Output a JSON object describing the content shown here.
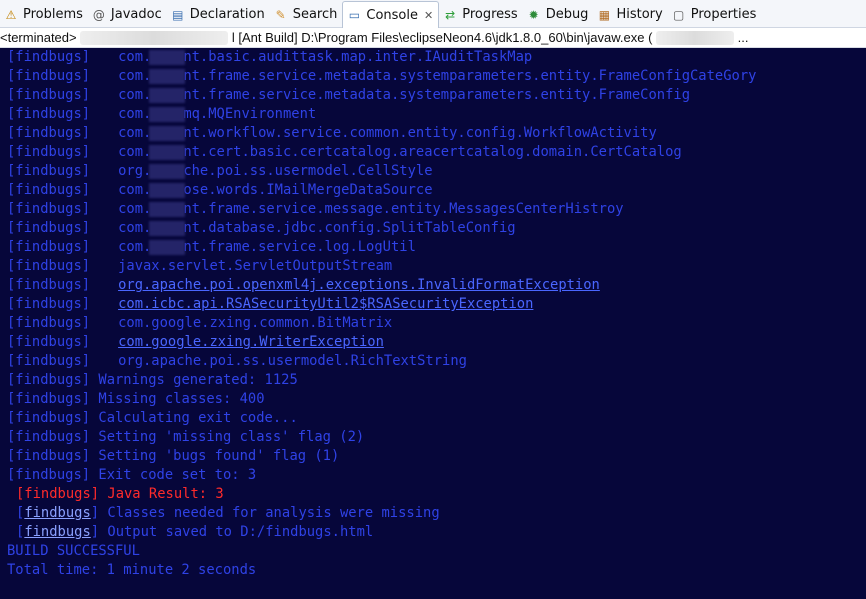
{
  "tabs": [
    {
      "label": "Problems",
      "icon": "problems-icon",
      "glyph": "⚠",
      "color": "#c08000"
    },
    {
      "label": "Javadoc",
      "icon": "javadoc-icon",
      "glyph": "@",
      "color": "#555555"
    },
    {
      "label": "Declaration",
      "icon": "declaration-icon",
      "glyph": "▤",
      "color": "#3a6fb0"
    },
    {
      "label": "Search",
      "icon": "search-icon",
      "glyph": "✎",
      "color": "#d09030"
    },
    {
      "label": "Console",
      "icon": "console-icon",
      "glyph": "▭",
      "color": "#3a6fb0",
      "active": true,
      "close": "✕"
    },
    {
      "label": "Progress",
      "icon": "progress-icon",
      "glyph": "⇄",
      "color": "#2e9e3a"
    },
    {
      "label": "Debug",
      "icon": "debug-icon",
      "glyph": "✹",
      "color": "#2e8c3a"
    },
    {
      "label": "History",
      "icon": "history-icon",
      "glyph": "▦",
      "color": "#b06a20"
    },
    {
      "label": "Properties",
      "icon": "properties-icon",
      "glyph": "▢",
      "color": "#555555"
    }
  ],
  "status": {
    "prefix": "<terminated>",
    "tail": "l [Ant Build] D:\\Program Files\\eclipseNeon4.6\\jdk1.8.0_60\\bin\\javaw.exe (",
    "end": "..."
  },
  "console": {
    "lines": [
      {
        "tag": "[findbugs]",
        "pre": "com.",
        "text": "nt.basic.audittask.map.inter.IAuditTaskMap",
        "blur": true
      },
      {
        "tag": "[findbugs]",
        "pre": "com.",
        "text": "nt.frame.service.metadata.systemparameters.entity.FrameConfigCateGory",
        "blur": true
      },
      {
        "tag": "[findbugs]",
        "pre": "com.",
        "text": "nt.frame.service.metadata.systemparameters.entity.FrameConfig",
        "blur": true
      },
      {
        "tag": "[findbugs]",
        "pre": "com.",
        "text": "mq.MQEnvironment",
        "blur": true
      },
      {
        "tag": "[findbugs]",
        "pre": "com.",
        "text": "nt.workflow.service.common.entity.config.WorkflowActivity",
        "blur": true
      },
      {
        "tag": "[findbugs]",
        "pre": "com.",
        "text": "nt.cert.basic.certcatalog.areacertcatalog.domain.CertCatalog",
        "blur": true
      },
      {
        "tag": "[findbugs]",
        "pre": "org.",
        "text": "che.poi.ss.usermodel.CellStyle",
        "blur": true
      },
      {
        "tag": "[findbugs]",
        "pre": "com.",
        "text": "ose.words.IMailMergeDataSource",
        "blur": true
      },
      {
        "tag": "[findbugs]",
        "pre": "com.",
        "text": "nt.frame.service.message.entity.MessagesCenterHistroy",
        "blur": true
      },
      {
        "tag": "[findbugs]",
        "pre": "com.",
        "text": "nt.database.jdbc.config.SplitTableConfig",
        "blur": true
      },
      {
        "tag": "[findbugs]",
        "pre": "com.",
        "text": "nt.frame.service.log.LogUtil",
        "blur": true
      },
      {
        "tag": "[findbugs]",
        "text": "javax.servlet.ServletOutputStream"
      },
      {
        "tag": "[findbugs]",
        "text": "org.apache.poi.openxml4j.exceptions.InvalidFormatException",
        "link": true
      },
      {
        "tag": "[findbugs]",
        "text": "com.icbc.api.RSASecurityUtil2$RSASecurityException",
        "link": true
      },
      {
        "tag": "[findbugs]",
        "text": "com.google.zxing.common.BitMatrix"
      },
      {
        "tag": "[findbugs]",
        "text": "com.google.zxing.WriterException",
        "link": true
      },
      {
        "tag": "[findbugs]",
        "text": "org.apache.poi.ss.usermodel.RichTextString"
      },
      {
        "tag": "[findbugs]",
        "text": "Warnings generated: 1125",
        "msg": true
      },
      {
        "tag": "[findbugs]",
        "text": "Missing classes: 400",
        "msg": true
      },
      {
        "tag": "[findbugs]",
        "text": "Calculating exit code...",
        "msg": true
      },
      {
        "tag": "[findbugs]",
        "text": "Setting 'missing class' flag (2)",
        "msg": true
      },
      {
        "tag": "[findbugs]",
        "text": "Setting 'bugs found' flag (1)",
        "msg": true
      },
      {
        "tag": "[findbugs]",
        "text": "Exit code set to: 3",
        "msg": true
      },
      {
        "tag": "[findbugs]",
        "text": "Java Result: 3",
        "msg": true,
        "err": true
      },
      {
        "tag": "findbugs",
        "text": "Classes needed for analysis were missing",
        "msg": true,
        "taglink": true
      },
      {
        "tag": "findbugs",
        "text": "Output saved to D:/findbugs.html",
        "msg": true,
        "taglink": true
      },
      {
        "text": "BUILD SUCCESSFUL",
        "plain": true
      },
      {
        "text": "Total time: 1 minute 2 seconds",
        "plain": true
      }
    ]
  }
}
